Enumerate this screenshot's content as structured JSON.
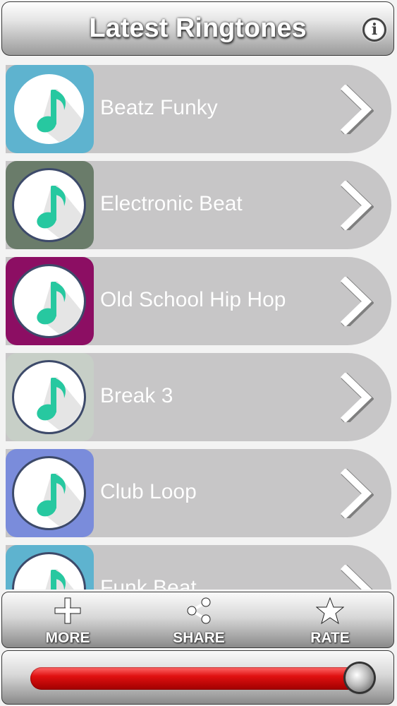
{
  "header": {
    "title": "Latest Ringtones",
    "info_icon": "info-icon",
    "info_glyph": "i"
  },
  "ringtones": [
    {
      "title": "Beatz Funky",
      "tile_color": "#5eb3cf",
      "ring_color": "#5eb3cf"
    },
    {
      "title": "Electronic Beat",
      "tile_color": "#6a7c6a",
      "ring_color": "#3d4a6a"
    },
    {
      "title": "Old School Hip Hop",
      "tile_color": "#8c0e63",
      "ring_color": "#3d4a6a"
    },
    {
      "title": "Break 3",
      "tile_color": "#c7cfc7",
      "ring_color": "#3d4a6a"
    },
    {
      "title": "Club Loop",
      "tile_color": "#7a8cdb",
      "ring_color": "#3d4a6a"
    },
    {
      "title": "Funk Beat",
      "tile_color": "#5eb3cf",
      "ring_color": "#3d4a6a"
    }
  ],
  "note_color": "#27c8a0",
  "toolbar": {
    "more_label": "MORE",
    "share_label": "SHARE",
    "rate_label": "RATE"
  },
  "volume": {
    "level": 0.96
  }
}
